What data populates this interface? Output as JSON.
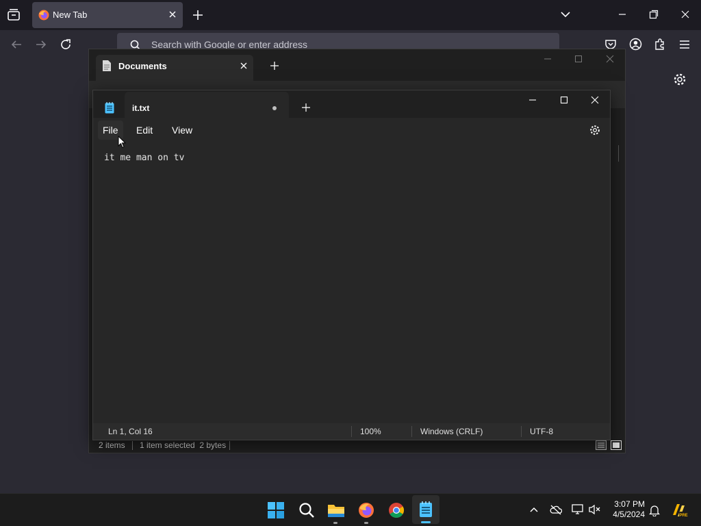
{
  "browser": {
    "tab_title": "New Tab",
    "url_placeholder": "Search with Google or enter address"
  },
  "explorer": {
    "tab_title": "Documents",
    "status_items": "2 items",
    "status_selected": "1 item selected  2 bytes"
  },
  "notepad": {
    "tab_title": "it.txt",
    "menu": {
      "file": "File",
      "edit": "Edit",
      "view": "View"
    },
    "content": "it me man on tv",
    "status": {
      "position": "Ln 1, Col 16",
      "zoom": "100%",
      "line_ending": "Windows (CRLF)",
      "encoding": "UTF-8"
    }
  },
  "taskbar": {
    "time": "3:07 PM",
    "date": "4/5/2024"
  },
  "colors": {
    "firefox_bg": "#1c1b22",
    "notepad_bg": "#272727",
    "accent": "#4cc2ff"
  }
}
